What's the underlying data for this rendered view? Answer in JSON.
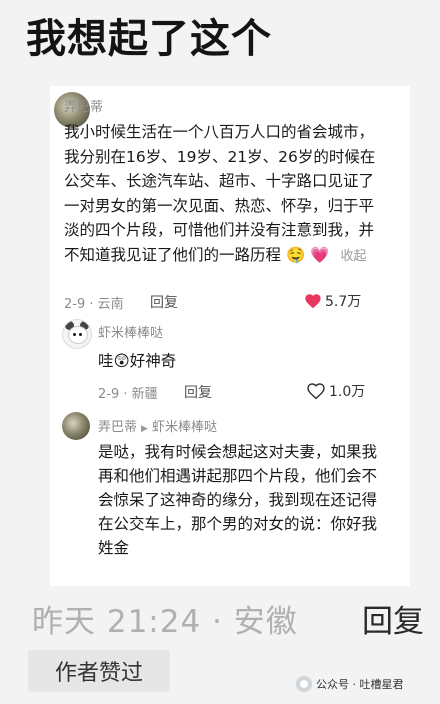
{
  "headline": "我想起了这个",
  "comment": {
    "username": "弄巴蒂",
    "lines": [
      "我小时候生活在一个八百万人口的省会城市，",
      "我分别在16岁、19岁、21岁、26岁的时候在",
      "公交车、长途汽车站、超市、十字路口见证了",
      "一对男女的第一次见面、热恋、怀孕，归于平",
      "淡的四个片段，可惜他们并没有注意到我，并",
      "不知道我见证了他们的一路历程"
    ],
    "emoji": "🤤",
    "heart": "💗",
    "collect": "收起",
    "date_loc": "2-9 · 云南",
    "reply": "回复",
    "likes": "5.7万"
  },
  "reply1": {
    "username": "虾米棒棒哒",
    "text_before": "哇",
    "emoji": "😲",
    "text_after": "好神奇",
    "date_loc": "2-9 · 新疆",
    "reply": "回复",
    "likes": "1.0万"
  },
  "reply2": {
    "username": "弄巴蒂",
    "reply_to": "虾米棒棒哒",
    "lines": [
      "是哒，我有时候会想起这对夫妻，如果我",
      "再和他们相遇讲起那四个片段，他们会不",
      "会惊呆了这神奇的缘分，我到现在还记得",
      "在公交车上，那个男的对女的说：你好我",
      "姓金"
    ]
  },
  "footer": {
    "meta": "昨天 21:24 · 安徽",
    "reply": "回复",
    "badge": "作者赞过",
    "watermark": "公众号 · 吐槽星君"
  },
  "colors": {
    "like_heart": "#e8385f",
    "collect": "#9a9a9a"
  }
}
